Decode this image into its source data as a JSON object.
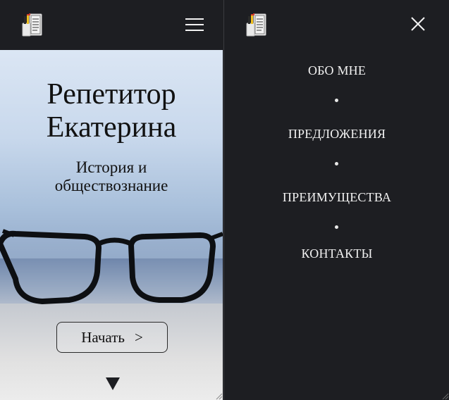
{
  "left": {
    "logo_icon": "notebook-pens-icon",
    "menu_icon": "hamburger-menu-icon",
    "hero": {
      "title": "Репетитор Екатерина",
      "subtitle": "История и\nобществознание",
      "start_label": "Начать",
      "start_arrow": ">",
      "scroll_icon": "triangle-down-icon"
    }
  },
  "right": {
    "logo_icon": "notebook-pens-icon",
    "close_icon": "close-x-icon",
    "nav": [
      {
        "label": "ОБО МНЕ"
      },
      {
        "label": "ПРЕДЛОЖЕНИЯ"
      },
      {
        "label": "ПРЕИМУЩЕСТВА"
      },
      {
        "label": "КОНТАКТЫ"
      }
    ]
  },
  "colors": {
    "dark_bg": "#1d1e22",
    "text_light": "#f2f2f2",
    "text_dark": "#111111"
  }
}
